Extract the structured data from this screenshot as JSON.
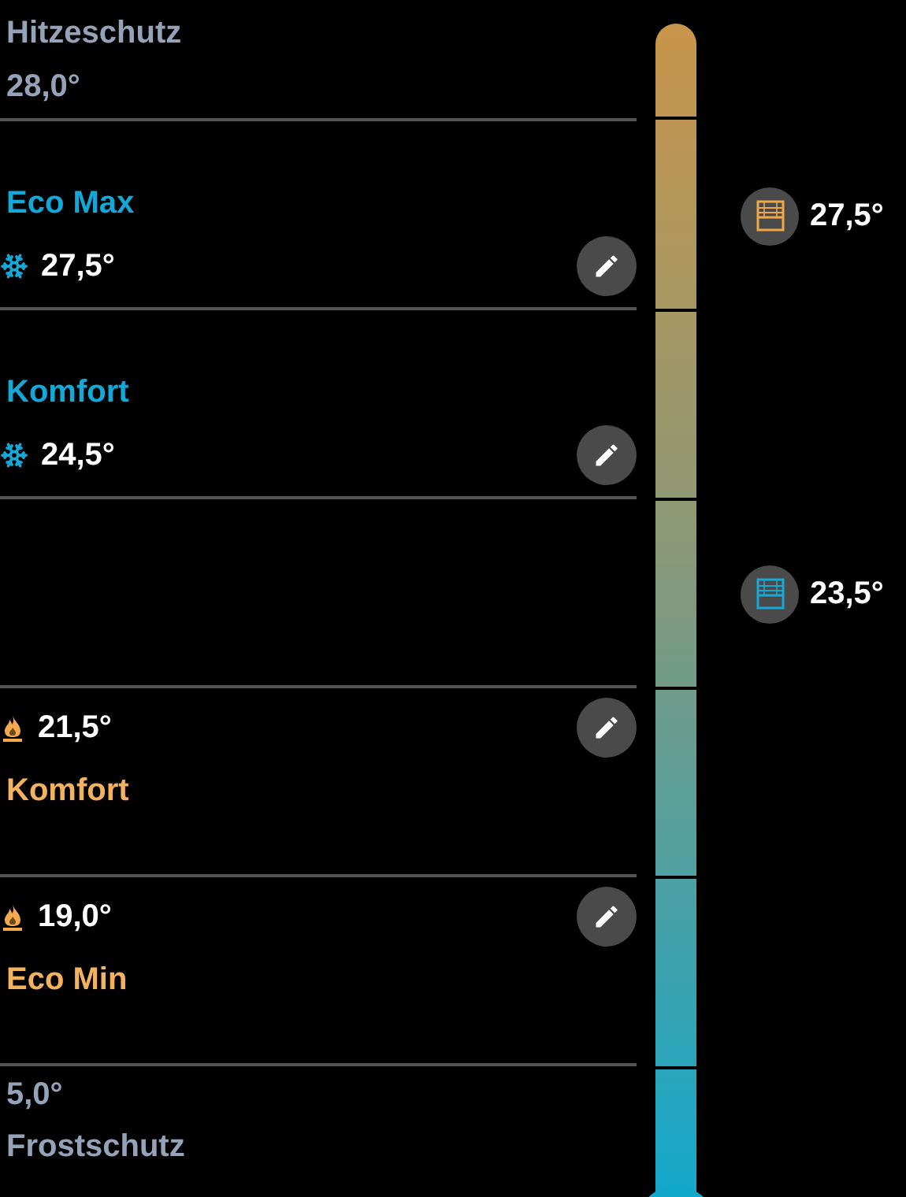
{
  "upper_limit": {
    "label": "Hitzeschutz",
    "reading": "28,0°"
  },
  "rows": [
    {
      "kind": "cool",
      "label": "Eco Max",
      "reading": "27,5°",
      "marker": {
        "reading": "27,5°",
        "color": "#f0a848"
      }
    },
    {
      "kind": "cool",
      "label": "Komfort",
      "reading": "24,5°"
    },
    {
      "kind": "empty",
      "marker": {
        "reading": "23,5°",
        "color": "#18a8d8"
      }
    },
    {
      "kind": "heat",
      "label": "Komfort",
      "reading": "21,5°"
    },
    {
      "kind": "heat",
      "label": "Eco Min",
      "reading": "19,0°"
    }
  ],
  "lower_limit": {
    "reading": "5,0°",
    "label": "Frostschutz"
  }
}
